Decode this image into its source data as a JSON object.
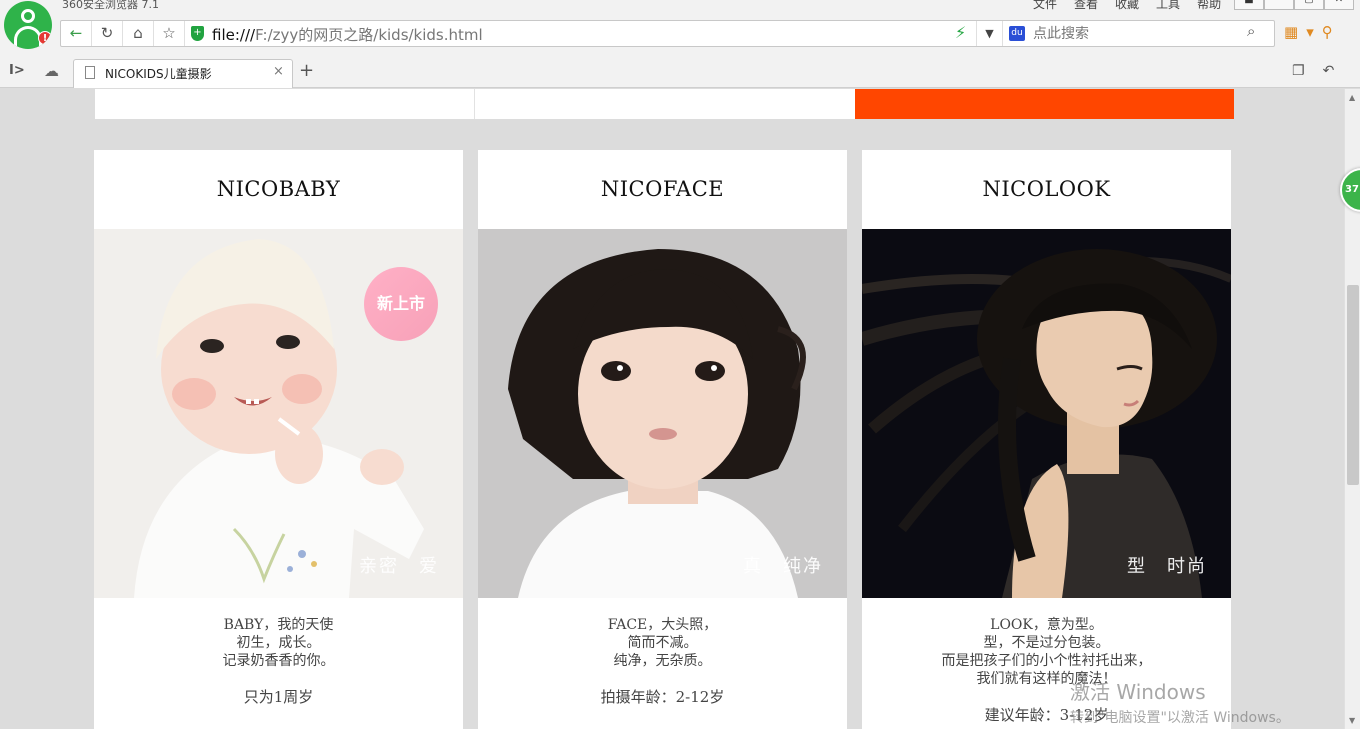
{
  "browser": {
    "app_title": "360安全浏览器 7.1",
    "menu": [
      "文件",
      "查看",
      "收藏",
      "工具",
      "帮助"
    ],
    "url_scheme": "file:///",
    "url_path": "F:/zyy的网页之路/kids/kids.html",
    "search_placeholder": "点此搜索",
    "tab_title": "NICOKIDS儿童摄影",
    "float_ball_text": "37"
  },
  "colors": {
    "accent": "#ff4600",
    "badge": "#f7a1b8",
    "browser_green": "#2fb34a"
  },
  "icons": [
    "user-avatar-icon",
    "back-icon",
    "reload-icon",
    "home-icon",
    "star-icon",
    "shield-icon",
    "lightning-icon",
    "search-icon",
    "close-icon",
    "plus-icon"
  ],
  "cards": [
    {
      "title": "NICOBABY",
      "badge": "新上市",
      "tagline": "亲密　爱",
      "lines": [
        "BABY，我的天使",
        "初生，成长。",
        "记录奶香香的你。"
      ],
      "age": "只为1周岁"
    },
    {
      "title": "NICOFACE",
      "tagline": "真　纯净",
      "lines": [
        "FACE，大头照，",
        "简而不减。",
        "纯净，无杂质。"
      ],
      "age": "拍摄年龄：2-12岁"
    },
    {
      "title": "NICOLOOK",
      "tagline": "型　时尚",
      "lines": [
        "LOOK，意为型。",
        "型，不是过分包装。",
        "而是把孩子们的小个性衬托出来，",
        "我们就有这样的魔法！"
      ],
      "age": "建议年龄：3-12岁"
    }
  ],
  "watermark": {
    "line1": "激活 Windows",
    "line2": "转到\"电脑设置\"以激活 Windows。"
  }
}
